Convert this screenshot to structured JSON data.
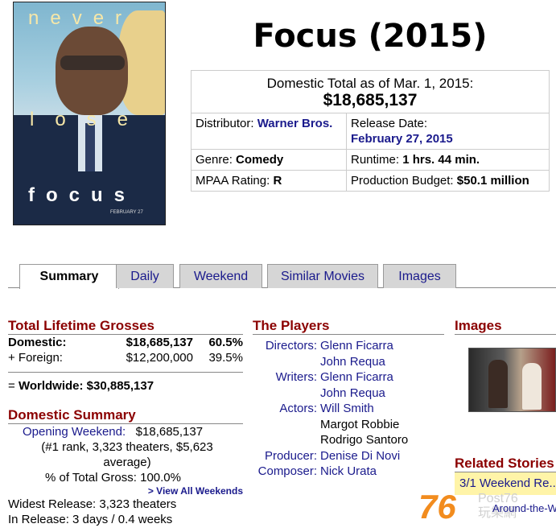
{
  "poster": {
    "word1": "never",
    "word2": "lose",
    "word3": "focus",
    "date": "FEBRUARY 27"
  },
  "movie": {
    "title": "Focus (2015)",
    "domestic_total_label": "Domestic Total as of Mar. 1, 2015:",
    "domestic_total_value": "$18,685,137",
    "distributor_label": "Distributor:",
    "distributor_value": "Warner Bros.",
    "release_label": "Release Date:",
    "release_value": "February 27, 2015",
    "genre_label": "Genre:",
    "genre_value": "Comedy",
    "runtime_label": "Runtime:",
    "runtime_value": "1 hrs. 44 min.",
    "mpaa_label": "MPAA Rating:",
    "mpaa_value": "R",
    "budget_label": "Production Budget:",
    "budget_value": "$50.1 million"
  },
  "tabs": [
    {
      "label": "Summary",
      "active": true
    },
    {
      "label": "Daily",
      "active": false
    },
    {
      "label": "Weekend",
      "active": false
    },
    {
      "label": "Similar Movies",
      "active": false
    },
    {
      "label": "Images",
      "active": false
    }
  ],
  "lifetime": {
    "heading": "Total Lifetime Grosses",
    "domestic_label": "Domestic:",
    "domestic_value": "$18,685,137",
    "domestic_pct": "60.5%",
    "foreign_label": "+ Foreign:",
    "foreign_value": "$12,200,000",
    "foreign_pct": "39.5%",
    "worldwide_prefix": "=",
    "worldwide_label": "Worldwide:",
    "worldwide_value": "$30,885,137"
  },
  "domestic_summary": {
    "heading": "Domestic Summary",
    "opening_label": "Opening Weekend:",
    "opening_value": "$18,685,137",
    "opening_detail": "(#1 rank, 3,323 theaters, $5,623 average)",
    "pct_label": "% of Total Gross:",
    "pct_value": "100.0%",
    "view_all": "> View All Weekends",
    "widest": "Widest Release: 3,323 theaters",
    "in_release": "In Release: 3 days / 0.4 weeks"
  },
  "players": {
    "heading": "The Players",
    "rows": [
      {
        "role": "Directors:",
        "name": "Glenn Ficarra"
      },
      {
        "role": "",
        "name": "John Requa"
      },
      {
        "role": "Writers:",
        "name": "Glenn Ficarra"
      },
      {
        "role": "",
        "name": "John Requa"
      },
      {
        "role": "Actors:",
        "name": "Will Smith"
      },
      {
        "role": "",
        "name": "Margot Robbie"
      },
      {
        "role": "",
        "name": "Rodrigo Santoro"
      },
      {
        "role": "Producer:",
        "name": "Denise Di Novi"
      },
      {
        "role": "Composer:",
        "name": "Nick Urata"
      }
    ]
  },
  "images": {
    "heading": "Images"
  },
  "related": {
    "heading": "Related Stories",
    "story": "3/1 Weekend Re..."
  },
  "watermark": {
    "number": "76",
    "brand": "Post76",
    "cn": "玩樂網",
    "overlay_text": "Around-the-W"
  }
}
